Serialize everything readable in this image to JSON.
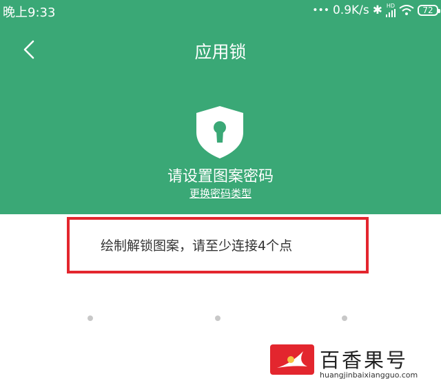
{
  "status_bar": {
    "time": "晚上9:33",
    "dots": "•••",
    "speed": "0.9K/s",
    "bluetooth": "✱",
    "hd_label": "HD",
    "battery": "72"
  },
  "header": {
    "title": "应用锁",
    "prompt": "请设置图案密码",
    "change_link": "更换密码类型"
  },
  "hint": {
    "text": "绘制解锁图案，请至少连接4个点"
  },
  "watermark": {
    "title": "百香果号",
    "url": "huangjinbaixiangguo.com"
  },
  "colors": {
    "header_bg": "#3aa876",
    "highlight_border": "#e3262e",
    "pattern_dot": "#c8c8c8"
  }
}
